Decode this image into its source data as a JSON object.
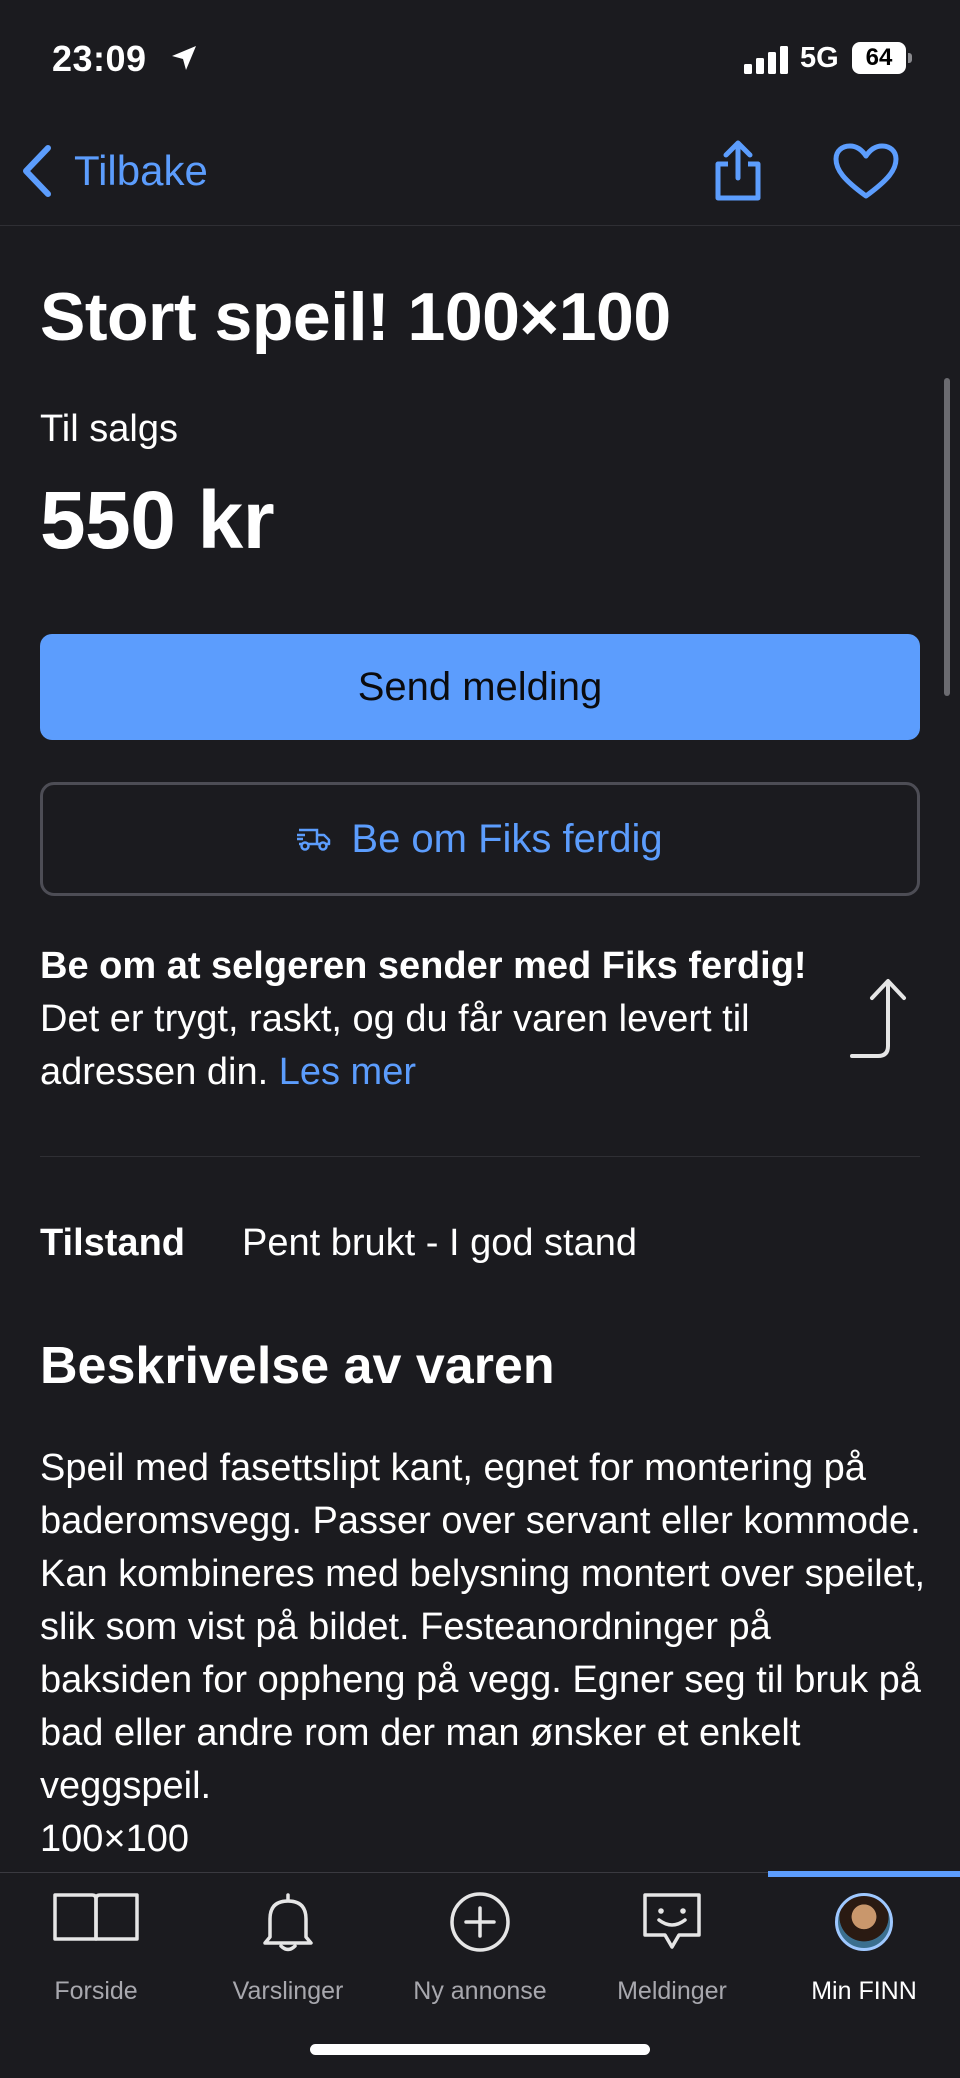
{
  "status_bar": {
    "time": "23:09",
    "network": "5G",
    "battery": "64",
    "icons": [
      "location-arrow-icon",
      "signal-icon",
      "battery-icon"
    ]
  },
  "nav": {
    "back_label": "Tilbake",
    "icons": [
      "chevron-left-icon",
      "share-icon",
      "heart-icon"
    ]
  },
  "listing": {
    "title": "Stort speil! 100×100",
    "sale_type": "Til salgs",
    "price": "550 kr"
  },
  "actions": {
    "send_message": "Send melding",
    "fiks_ferdig": "Be om Fiks ferdig"
  },
  "fiks_info": {
    "bold": "Be om at selgeren sender med Fiks ferdig!",
    "text": " Det er trygt, raskt, og du får varen levert til adressen din. ",
    "link": "Les mer"
  },
  "condition": {
    "label": "Tilstand",
    "value": "Pent brukt - I god stand"
  },
  "description": {
    "title": "Beskrivelse av varen",
    "text": "Speil med fasettslipt kant, egnet for montering på baderomsvegg. Passer over servant eller kommode. Kan kombineres med belysning montert over speilet, slik som vist på bildet. Festeanordninger på baksiden for oppheng på vegg. Egner seg til bruk på bad eller andre rom der man ønsker et enkelt veggspeil.\n100×100"
  },
  "tab_bar": {
    "tabs": [
      {
        "label": "Forside",
        "icon": "book-icon"
      },
      {
        "label": "Varslinger",
        "icon": "bell-icon"
      },
      {
        "label": "Ny annonse",
        "icon": "plus-circle-icon"
      },
      {
        "label": "Meldinger",
        "icon": "chat-icon"
      },
      {
        "label": "Min FINN",
        "icon": "avatar"
      }
    ],
    "active": "Min FINN"
  },
  "colors": {
    "background": "#1b1b1f",
    "accent": "#5c9dfd",
    "text": "#ffffff"
  }
}
